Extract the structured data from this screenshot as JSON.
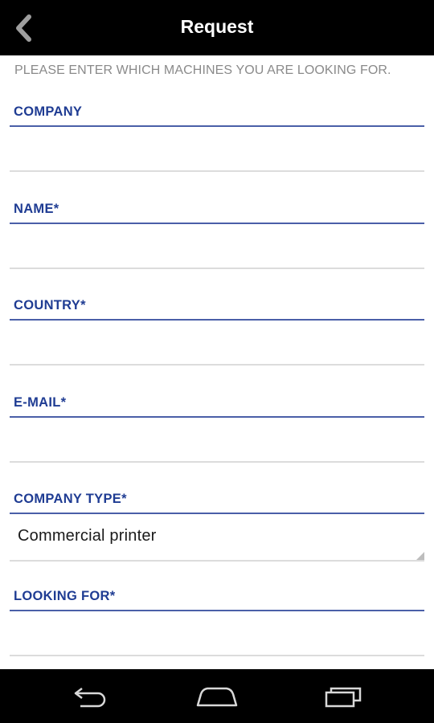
{
  "header": {
    "title": "Request",
    "back_icon": "chevron-left-icon"
  },
  "intro_text": "PLEASE ENTER WHICH MACHINES YOU ARE LOOKING FOR.",
  "fields": [
    {
      "label": "COMPANY",
      "value": ""
    },
    {
      "label": "NAME*",
      "value": ""
    },
    {
      "label": "COUNTRY*",
      "value": ""
    },
    {
      "label": "E-MAIL*",
      "value": ""
    },
    {
      "label": "COMPANY TYPE*",
      "value": "Commercial printer"
    },
    {
      "label": "LOOKING FOR*",
      "value": ""
    }
  ],
  "nav": {
    "back_icon": "back-arrow-icon",
    "home_icon": "home-icon",
    "recents_icon": "recent-apps-icon"
  },
  "colors": {
    "label": "#1f3c93",
    "topbar": "#000000",
    "intro": "#8a8a8a"
  }
}
